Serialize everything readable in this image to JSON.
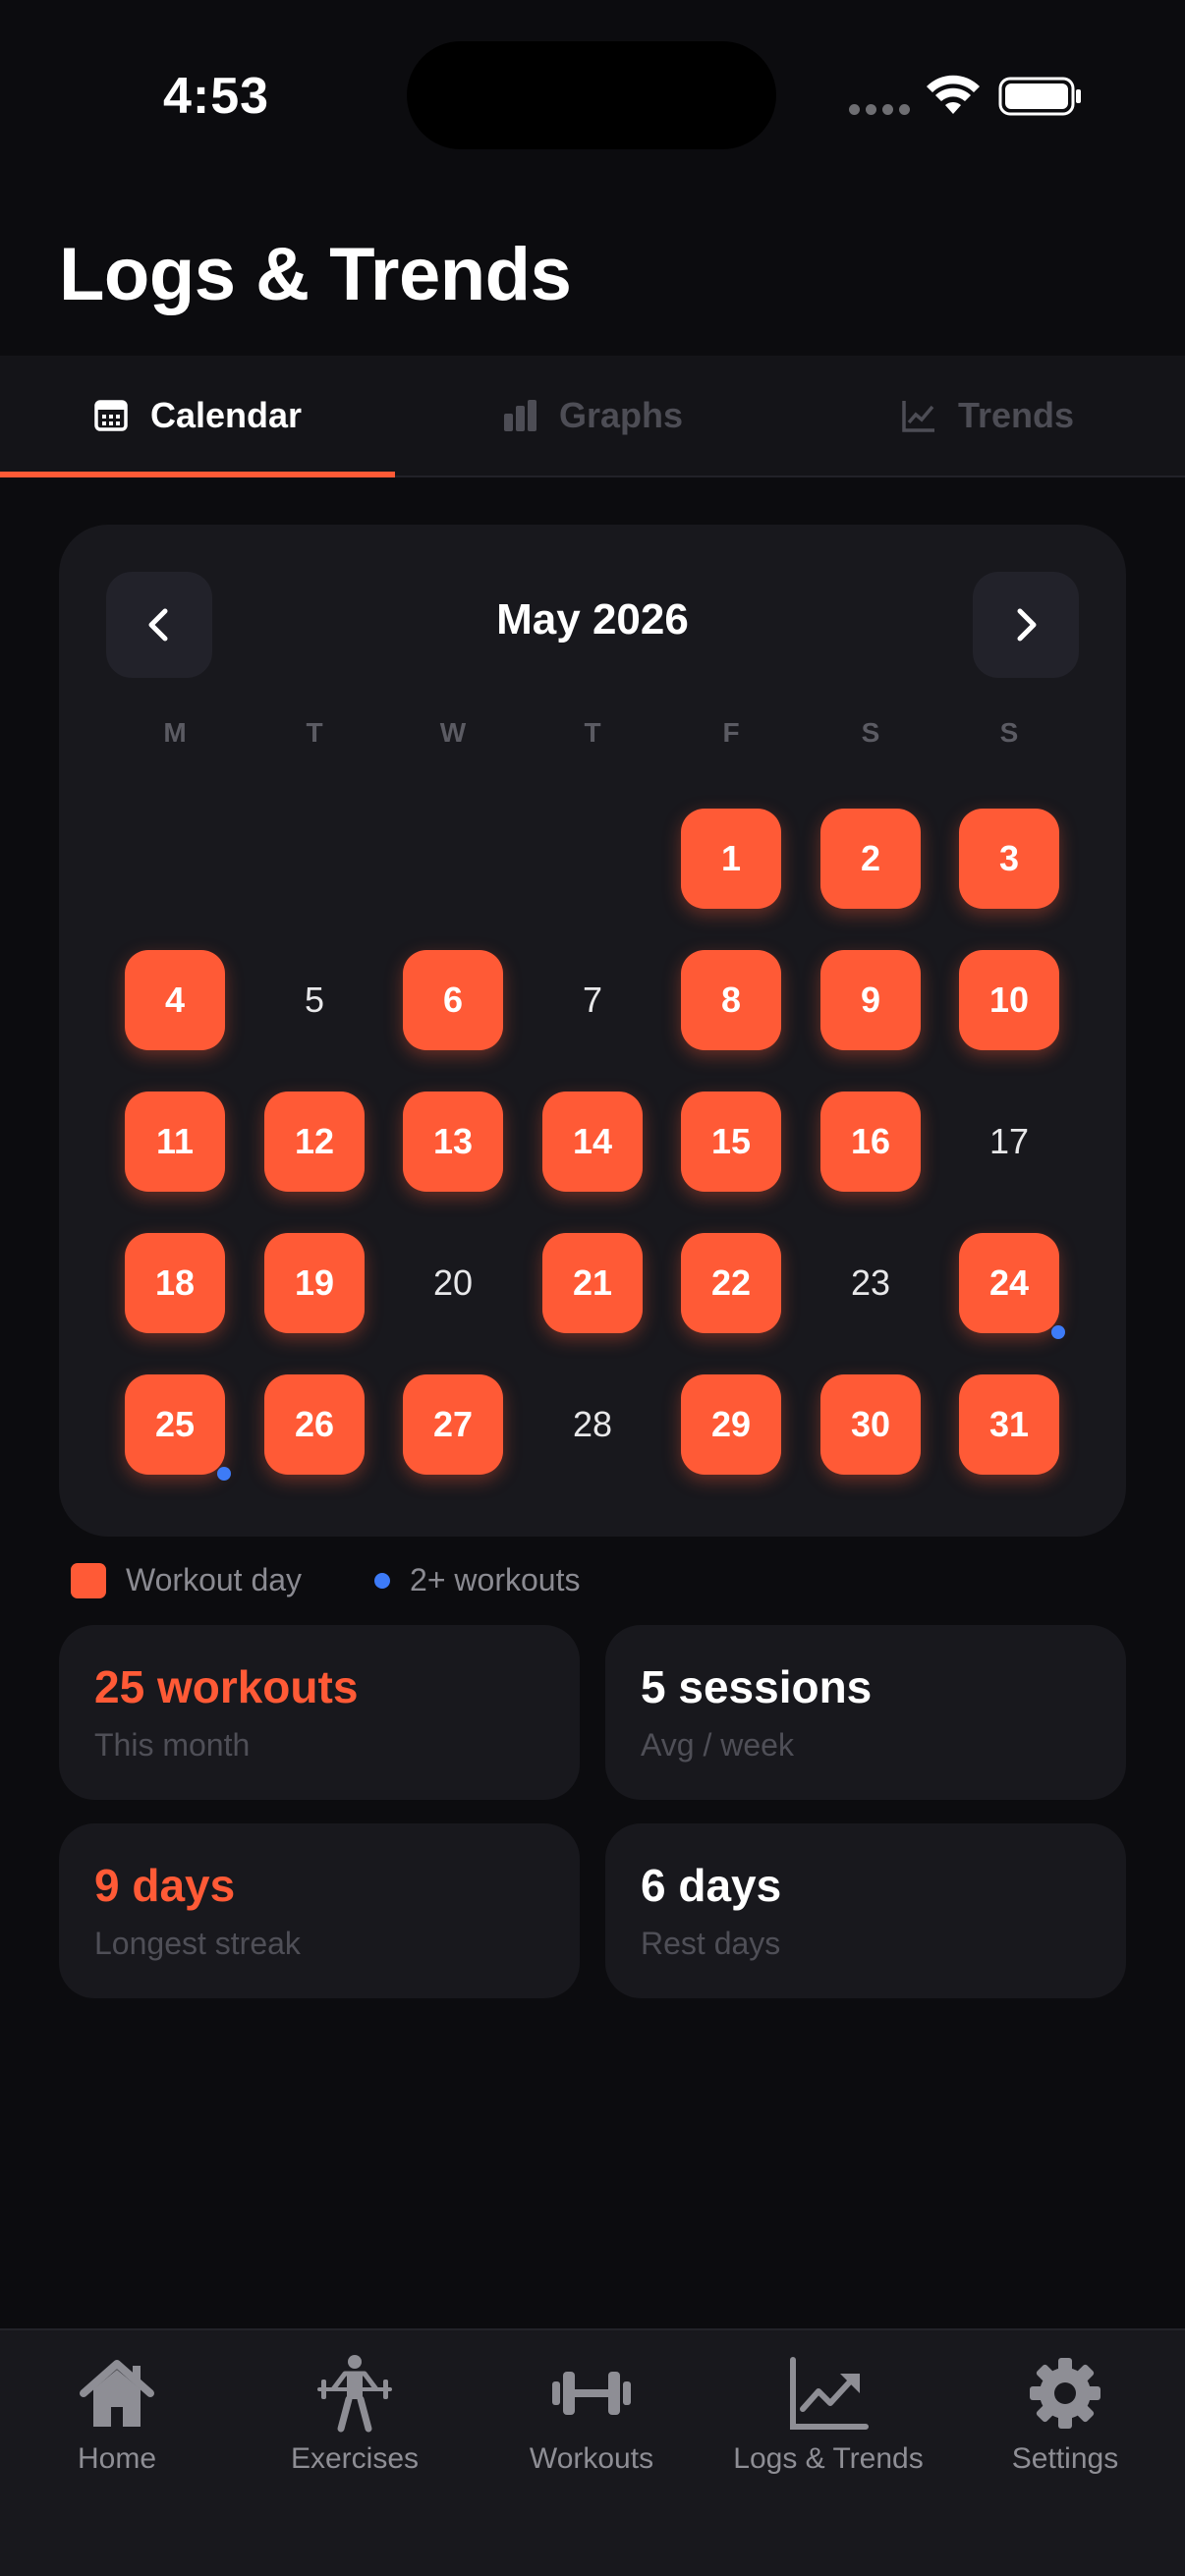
{
  "status_bar": {
    "time": "4:53"
  },
  "header": {
    "title": "Logs & Trends"
  },
  "tabs": [
    {
      "label": "Calendar",
      "icon": "calendar-icon",
      "active": true
    },
    {
      "label": "Graphs",
      "icon": "bar-chart-icon",
      "active": false
    },
    {
      "label": "Trends",
      "icon": "trend-line-icon",
      "active": false
    }
  ],
  "calendar": {
    "month_title": "May 2026",
    "weekdays": [
      "M",
      "T",
      "W",
      "T",
      "F",
      "S",
      "S"
    ],
    "first_weekday_index": 4,
    "days_in_month": 31,
    "workout_days": [
      1,
      2,
      3,
      4,
      6,
      8,
      9,
      10,
      11,
      12,
      13,
      14,
      15,
      16,
      18,
      19,
      21,
      22,
      24,
      25,
      26,
      27,
      29,
      30,
      31
    ],
    "multi_workout_days": [
      24,
      25
    ]
  },
  "legend": {
    "workout_label": "Workout day",
    "multi_label": "2+ workouts"
  },
  "stats": [
    {
      "value": "25 workouts",
      "label": "This month",
      "accent": true
    },
    {
      "value": "5 sessions",
      "label": "Avg / week",
      "accent": false
    },
    {
      "value": "9 days",
      "label": "Longest streak",
      "accent": true
    },
    {
      "value": "6 days",
      "label": "Rest days",
      "accent": false
    }
  ],
  "tab_bar": [
    {
      "label": "Home",
      "icon": "home-icon",
      "active": false
    },
    {
      "label": "Exercises",
      "icon": "weightlifter-icon",
      "active": false
    },
    {
      "label": "Workouts",
      "icon": "dumbbell-icon",
      "active": false
    },
    {
      "label": "Logs & Trends",
      "icon": "trend-chart-icon",
      "active": true
    },
    {
      "label": "Settings",
      "icon": "gear-icon",
      "active": false
    }
  ],
  "colors": {
    "accent": "#ff5a36",
    "multi_dot": "#3d7bf7",
    "background": "#0c0c0f",
    "card": "#18181d"
  }
}
